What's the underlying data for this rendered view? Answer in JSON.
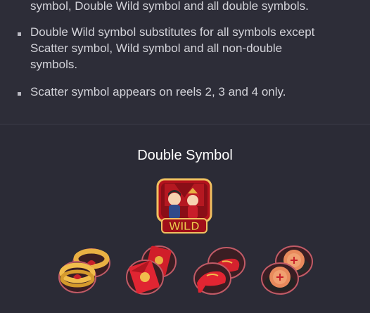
{
  "rules": {
    "line_1": "symbol, Double Wild symbol and all double symbols.",
    "line_2": "Double Wild symbol substitutes for all symbols except",
    "line_3": "Scatter symbol, Wild symbol and all non-double",
    "line_4": "symbols.",
    "line_5": "Scatter symbol appears on reels 2, 3 and 4 only."
  },
  "section": {
    "title": "Double Symbol"
  },
  "symbols": {
    "wild_label": "WILD",
    "items": [
      {
        "icon": "double-wild-couple-icon"
      },
      {
        "icon": "double-gold-rings-icon"
      },
      {
        "icon": "double-red-envelopes-icon"
      },
      {
        "icon": "double-red-shoes-icon"
      },
      {
        "icon": "double-mooncakes-icon"
      }
    ]
  },
  "colors": {
    "background": "#2b2b36",
    "text": "#d3d3d9",
    "title": "#ffffff",
    "accent_red": "#c8202a",
    "accent_gold": "#e9b043"
  }
}
